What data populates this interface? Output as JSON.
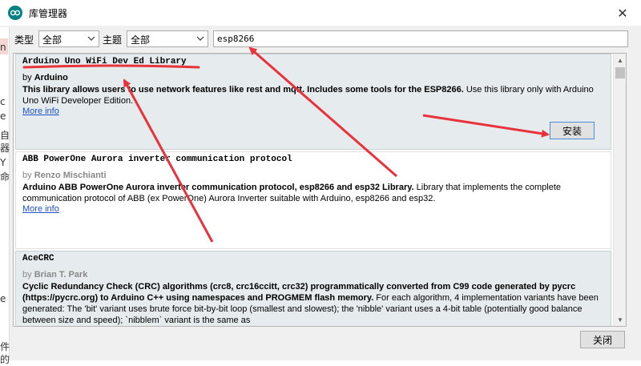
{
  "window": {
    "title": "库管理器",
    "close_glyph": "✕"
  },
  "filters": {
    "type_label": "类型",
    "type_value": "全部",
    "topic_label": "主题",
    "topic_value": "全部",
    "search_value": "esp8266"
  },
  "background_fragments": [
    "n",
    "c",
    "e",
    "自",
    "器",
    "Y",
    "命",
    "e",
    "件",
    "的"
  ],
  "libraries": [
    {
      "name": "Arduino Uno WiFi Dev Ed Library",
      "by_label": "by",
      "author": "Arduino",
      "desc_bold": "This library allows users to use network features like rest and mqtt. Includes some tools for the ESP8266.",
      "desc_rest": " Use this library only with Arduino Uno WiFi Developer Edition.",
      "more": "More info",
      "install_label": "安装",
      "selected": true
    },
    {
      "name": "ABB PowerOne Aurora inverter communication protocol",
      "by_label": "by",
      "author": "Renzo Mischianti",
      "desc_bold": "Arduino ABB PowerOne Aurora inverter communication protocol, esp8266 and esp32 Library.",
      "desc_rest": " Library that implements the complete communication protocol of ABB (ex PowerOne) Aurora Inverter suitable with Arduino, esp8266 and esp32.",
      "more": "More info",
      "selected": false
    },
    {
      "name": "AceCRC",
      "by_label": "by",
      "author": "Brian T. Park",
      "desc_bold": "Cyclic Redundancy Check (CRC) algorithms (crc8, crc16ccitt, crc32) programmatically converted from C99 code generated by pycrc (https://pycrc.org) to Arduino C++ using namespaces and PROGMEM flash memory.",
      "desc_rest": " For each algorithm, 4 implementation variants have been generated: The 'bit' variant uses brute force bit-by-bit loop (smallest and slowest); the 'nibble' variant uses a 4-bit table (potentially good balance between size and speed); `nibblem` variant is the same as",
      "selected": false
    }
  ],
  "footer": {
    "close_label": "关闭"
  },
  "colors": {
    "annotation": "#e8323c",
    "link": "#1e50c8",
    "selected_bg": "#e6ecee"
  },
  "icons": {
    "app": "arduino-icon",
    "dropdown": "chevron-down-icon"
  }
}
